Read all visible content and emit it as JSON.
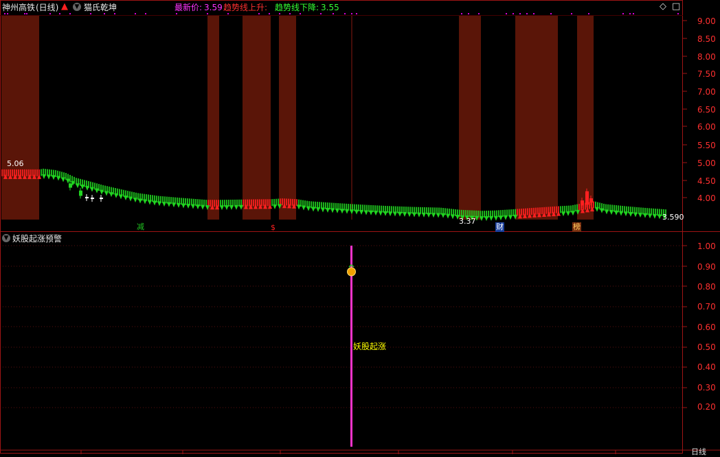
{
  "header": {
    "stock_name": "神州高铁",
    "period_label": "(日线)",
    "indicator_name": "猫氏乾坤",
    "latest_label": "最新价:",
    "latest_value": "3.59",
    "trend_up_label": "趋势线上升:",
    "trend_down_label": "趋势线下降:",
    "trend_down_value": "3.55"
  },
  "sub_panel": {
    "title": "妖股起涨预警",
    "signal_label": "妖股起涨"
  },
  "main_price_scale": [
    "9.00",
    "8.50",
    "8.00",
    "7.50",
    "7.00",
    "6.50",
    "6.00",
    "5.50",
    "5.00",
    "4.50",
    "4.00"
  ],
  "sub_scale": [
    "1.00",
    "0.90",
    "0.80",
    "0.70",
    "0.60",
    "0.50",
    "0.40",
    "0.30",
    "0.20"
  ],
  "price_labels": {
    "high": "5.06",
    "low": "3.37",
    "current": "3.590"
  },
  "markers": [
    {
      "text": "减",
      "color": "#21c321"
    },
    {
      "text": "$",
      "color": "#ff2020"
    },
    {
      "text": "财",
      "color": "#ffffff",
      "bg": "#1a3f9e"
    },
    {
      "text": "榜",
      "color": "#ffd060",
      "bg": "#7a3010"
    }
  ],
  "controls": {
    "diamond_icon": "◇",
    "square_icon": "□"
  },
  "bottom_period": "日线",
  "colors": {
    "up": "#ff2020",
    "down": "#21d421",
    "shade": "#5a1508",
    "border": "#a01414",
    "signal": "#ff33cc",
    "latest": "#ff33ff",
    "trend_up": "#ff3030",
    "trend_down": "#33ff33"
  }
}
